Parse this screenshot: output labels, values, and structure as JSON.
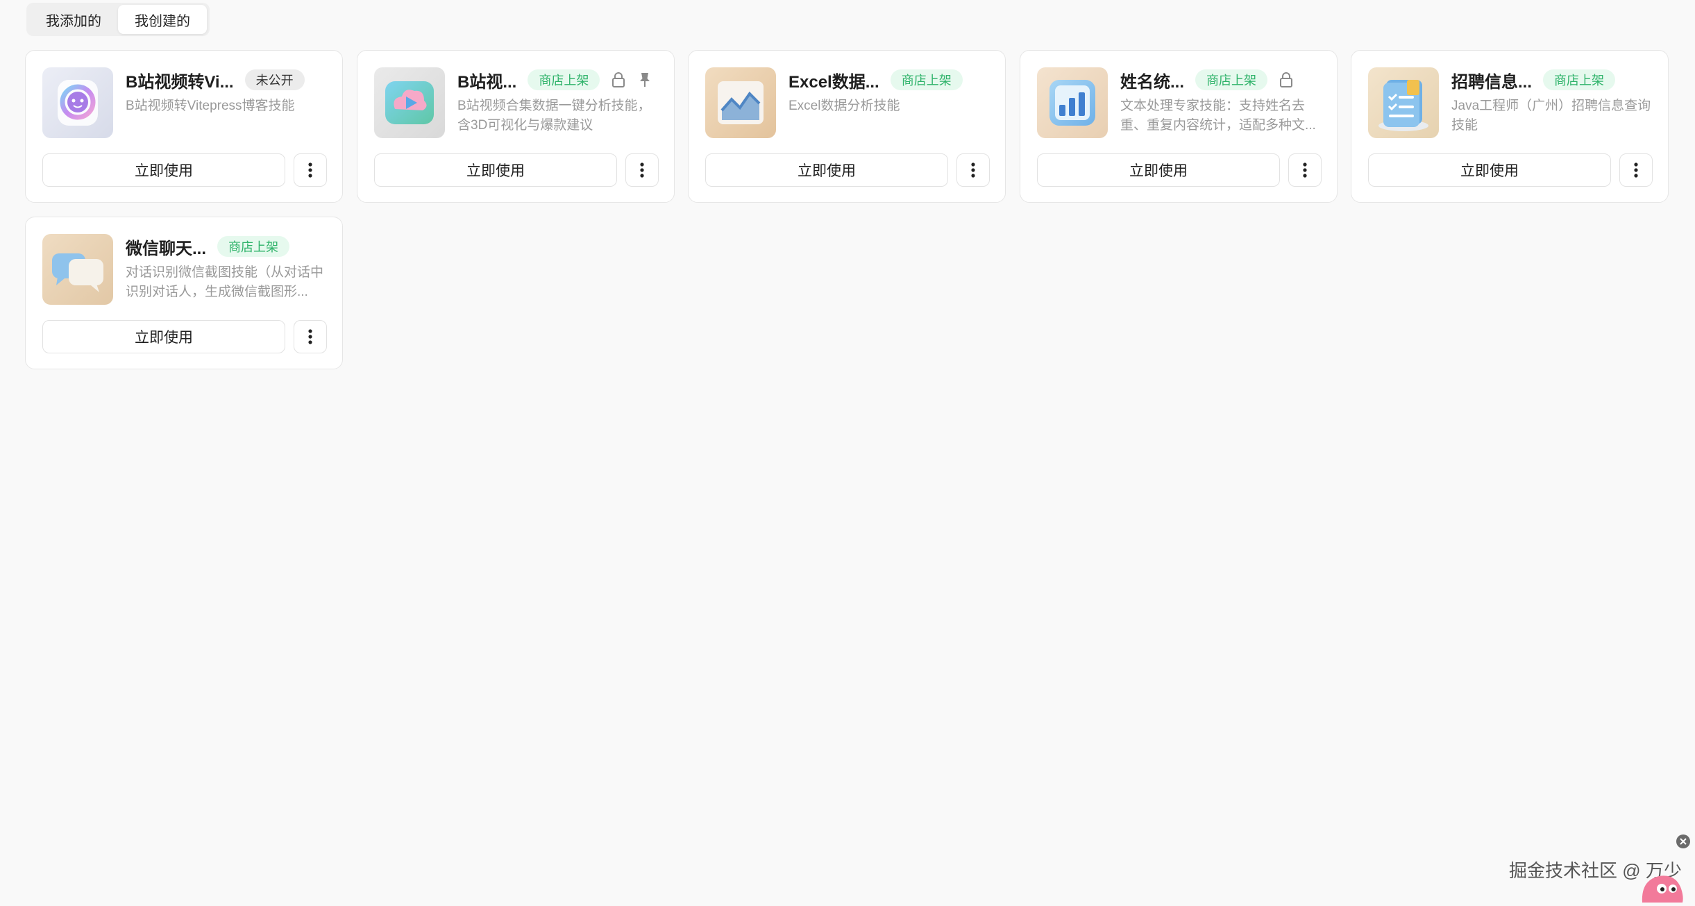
{
  "tabs": [
    {
      "label": "我添加的"
    },
    {
      "label": "我创建的"
    }
  ],
  "cards": [
    {
      "title": "B站视频转Vi...",
      "badge": "未公开",
      "description": "B站视频转Vitepress博客技能",
      "use_label": "立即使用",
      "icon": "robot-face-icon"
    },
    {
      "title": "B站视...",
      "badge": "商店上架",
      "description": "B站视频合集数据一键分析技能，含3D可视化与爆款建议",
      "use_label": "立即使用",
      "icon": "video-play-icon"
    },
    {
      "title": "Excel数据...",
      "badge": "商店上架",
      "description": "Excel数据分析技能",
      "use_label": "立即使用",
      "icon": "line-chart-icon"
    },
    {
      "title": "姓名统...",
      "badge": "商店上架",
      "description": "文本处理专家技能：支持姓名去重、重复内容统计，适配多种文...",
      "use_label": "立即使用",
      "icon": "bar-chart-icon"
    },
    {
      "title": "招聘信息...",
      "badge": "商店上架",
      "description": "Java工程师（广州）招聘信息查询技能",
      "use_label": "立即使用",
      "icon": "document-list-icon"
    },
    {
      "title": "微信聊天...",
      "badge": "商店上架",
      "description": "对话识别微信截图技能（从对话中识别对话人，生成微信截图形...",
      "use_label": "立即使用",
      "icon": "chat-bubbles-icon"
    }
  ],
  "watermark": "掘金技术社区 @ 万少",
  "colors": {
    "store_badge_bg": "#e6f9ee",
    "store_badge_text": "#2fb36a",
    "private_badge_bg": "#ececec"
  }
}
